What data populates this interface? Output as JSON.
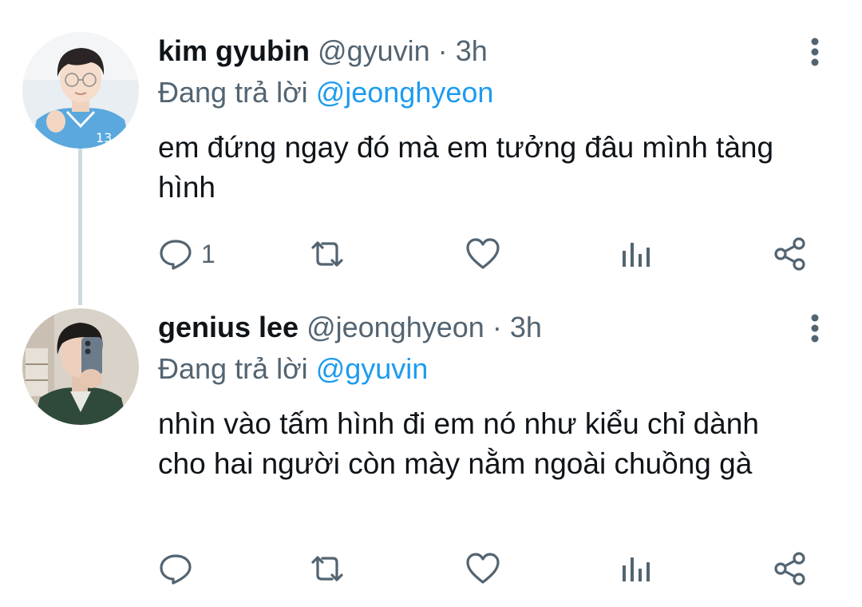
{
  "tweets": [
    {
      "display_name": "kim gyubin",
      "handle": "@gyuvin",
      "separator": "·",
      "time": "3h",
      "replying_prefix": "Đang trả lời",
      "replying_to": "@jeonghyeon",
      "text": "em đứng ngay đó mà em tưởng đâu mình tàng hình",
      "reply_count": "1",
      "avatar_icon": "avatar-photo-blue-shirt"
    },
    {
      "display_name": "genius lee",
      "handle": "@jeonghyeon",
      "separator": "·",
      "time": "3h",
      "replying_prefix": "Đang trả lời",
      "replying_to": "@gyuvin",
      "text": "nhìn vào tấm hình đi em nó như kiểu chỉ dành cho hai người còn mày nằm ngoài chuồng gà",
      "reply_count": "",
      "avatar_icon": "avatar-photo-mirror-selfie"
    }
  ],
  "colors": {
    "text_primary": "#0f1419",
    "text_secondary": "#536471",
    "link": "#1d9bf0",
    "thread_line": "#cfd9de"
  }
}
